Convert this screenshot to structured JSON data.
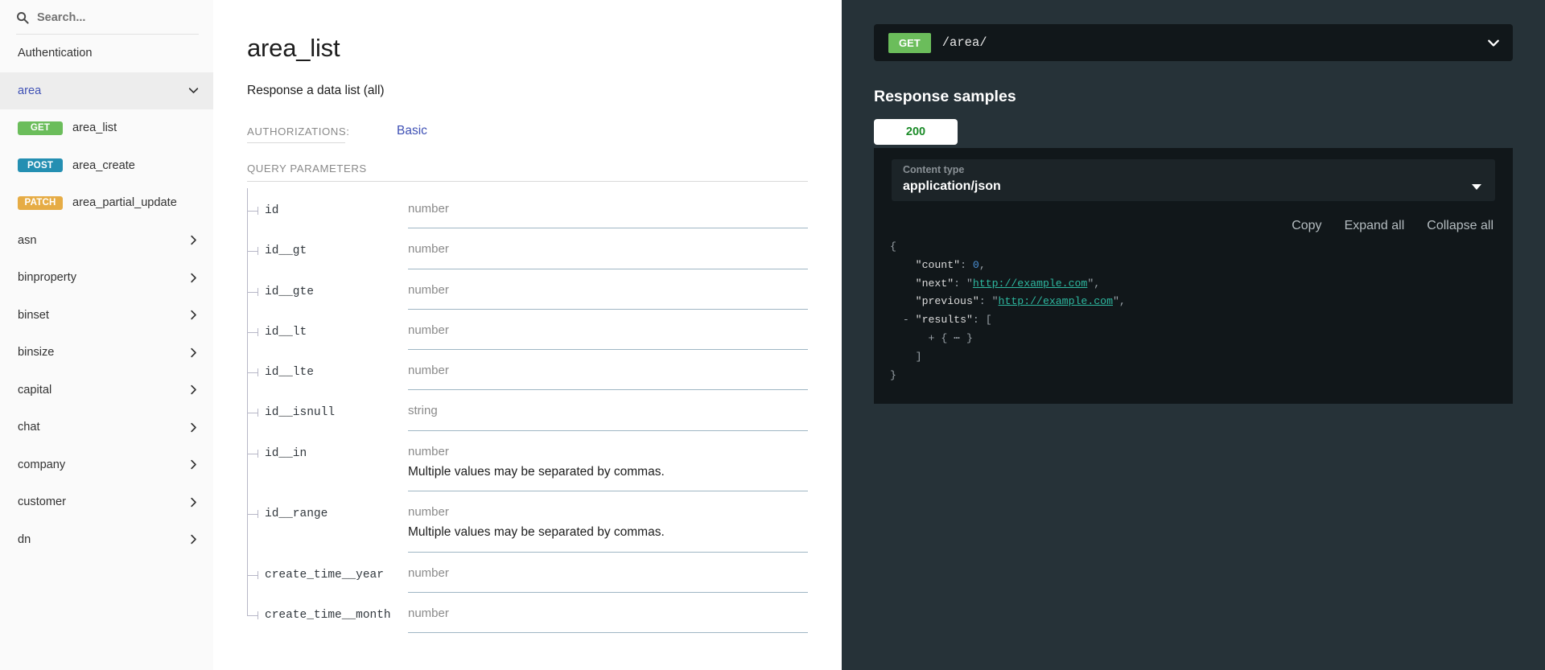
{
  "sidebar": {
    "search": {
      "placeholder": "Search...",
      "value": "",
      "icon": "search-icon"
    },
    "items": [
      {
        "label": "Authentication",
        "type": "link"
      },
      {
        "label": "area",
        "type": "group",
        "expanded": true,
        "icon": "chevron-down-icon"
      },
      {
        "label": "asn",
        "type": "group",
        "expanded": false,
        "icon": "chevron-right-icon"
      },
      {
        "label": "binproperty",
        "type": "group",
        "expanded": false,
        "icon": "chevron-right-icon"
      },
      {
        "label": "binset",
        "type": "group",
        "expanded": false,
        "icon": "chevron-right-icon"
      },
      {
        "label": "binsize",
        "type": "group",
        "expanded": false,
        "icon": "chevron-right-icon"
      },
      {
        "label": "capital",
        "type": "group",
        "expanded": false,
        "icon": "chevron-right-icon"
      },
      {
        "label": "chat",
        "type": "group",
        "expanded": false,
        "icon": "chevron-right-icon"
      },
      {
        "label": "company",
        "type": "group",
        "expanded": false,
        "icon": "chevron-right-icon"
      },
      {
        "label": "customer",
        "type": "group",
        "expanded": false,
        "icon": "chevron-right-icon"
      },
      {
        "label": "dn",
        "type": "group",
        "expanded": false,
        "icon": "chevron-right-icon"
      }
    ],
    "area_operations": [
      {
        "method": "GET",
        "label": "area_list",
        "color": "#6bbd5b"
      },
      {
        "method": "POST",
        "label": "area_create",
        "color": "#248fb2"
      },
      {
        "method": "PATCH",
        "label": "area_partial_update",
        "color": "#e6ac45"
      }
    ]
  },
  "main": {
    "title": "area_list",
    "description": "Response a data list  (all)",
    "authorizations_label": "AUTHORIZATIONS:",
    "authorizations_value": "Basic",
    "query_parameters_label": "QUERY PARAMETERS",
    "parameters": [
      {
        "name": "id",
        "type": "number",
        "note": ""
      },
      {
        "name": "id__gt",
        "type": "number",
        "note": ""
      },
      {
        "name": "id__gte",
        "type": "number",
        "note": ""
      },
      {
        "name": "id__lt",
        "type": "number",
        "note": ""
      },
      {
        "name": "id__lte",
        "type": "number",
        "note": ""
      },
      {
        "name": "id__isnull",
        "type": "string",
        "note": ""
      },
      {
        "name": "id__in",
        "type": "number",
        "note": "Multiple values may be separated by commas."
      },
      {
        "name": "id__range",
        "type": "number",
        "note": "Multiple values may be separated by commas."
      },
      {
        "name": "create_time__year",
        "type": "number",
        "note": ""
      },
      {
        "name": "create_time__month",
        "type": "number",
        "note": ""
      }
    ]
  },
  "right": {
    "endpoint": {
      "method": "GET",
      "path": "/area/",
      "chevron": "chevron-down-icon"
    },
    "response_samples_title": "Response samples",
    "status_tabs": [
      {
        "code": "200",
        "active": true
      }
    ],
    "content_type": {
      "label": "Content type",
      "value": "application/json"
    },
    "code_tools": [
      "Copy",
      "Expand all",
      "Collapse all"
    ],
    "json_sample": {
      "line_open": "{",
      "count_key": "\"count\"",
      "count_value": "0",
      "next_key": "\"next\"",
      "next_value": "http://example.com",
      "previous_key": "\"previous\"",
      "previous_value": "http://example.com",
      "results_key": "\"results\"",
      "results_toggle": "-",
      "results_open": "[",
      "results_item_toggle": "+",
      "results_item": "{ ⋯ }",
      "results_close": "]",
      "line_close": "}"
    }
  },
  "colors": {
    "get": "#6bbd5b",
    "post": "#248fb2",
    "patch": "#e6ac45",
    "accent": "#3f51b5",
    "panel_bg": "#263238",
    "code_bg": "#11171a",
    "status_200": "#1b8b28"
  }
}
